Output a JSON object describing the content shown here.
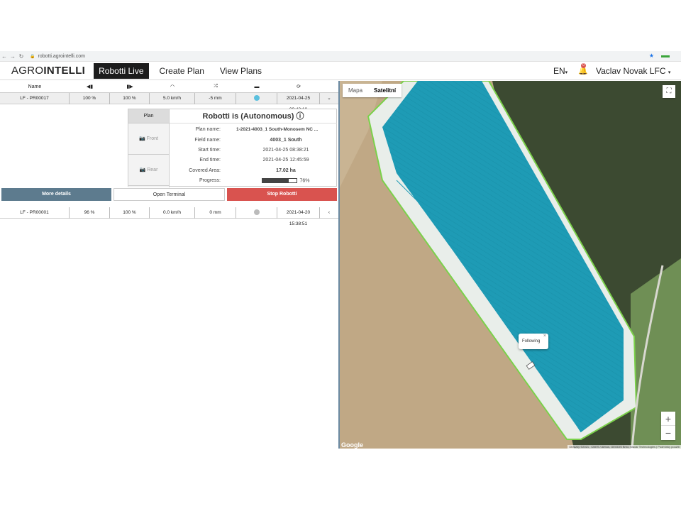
{
  "browser": {
    "url": "robotti.agrointelli.com"
  },
  "header": {
    "logo_light": "AGRO",
    "logo_bold": "INTELLI",
    "tabs": [
      {
        "label": "Robotti Live",
        "active": true
      },
      {
        "label": "Create Plan"
      },
      {
        "label": "View Plans"
      }
    ],
    "language": "EN",
    "notification_count": "0",
    "user": "Vaclav Novak LFC"
  },
  "table": {
    "name_header": "Name",
    "header_icons": [
      "fuel-left-icon",
      "fuel-icon",
      "speedometer-icon",
      "shuffle-icon",
      "monitor-icon",
      "refresh-icon"
    ],
    "rows": [
      {
        "name": "LF - PR00017",
        "fuel1": "100 %",
        "fuel2": "100 %",
        "speed": "5.0 km/h",
        "depth": "-5 mm",
        "status_color": "#5bc0de",
        "time": "2021-04-25 09:42:10",
        "toggle": "⌄"
      },
      {
        "name": "LF - PR00001",
        "fuel1": "96 %",
        "fuel2": "100 %",
        "speed": "0.0 km/h",
        "depth": "0 mm",
        "status_color": "#bbbbbb",
        "time": "2021-04-20 15:38:51",
        "toggle": "‹"
      }
    ]
  },
  "detail": {
    "tab_plan": "Plan",
    "tab_front": "Front",
    "tab_rear": "Rear",
    "title": "Robotti is (Autonomous)",
    "fields": [
      {
        "key": "Plan name:",
        "value": "1-2021-4003_1 South-Monosem NC ..."
      },
      {
        "key": "Field name:",
        "value": "4003_1 South"
      },
      {
        "key": "Start time:",
        "value": "2021-04-25 08:38:21"
      },
      {
        "key": "End time:",
        "value": "2021-04-25 12:45:59"
      },
      {
        "key": "Covered Area:",
        "value": "17.02 ha"
      }
    ],
    "progress_label": "Progress:",
    "progress_value": 76,
    "progress_text": "76%"
  },
  "actions": {
    "more": "More details",
    "terminal": "Open Terminal",
    "stop": "Stop Robotti"
  },
  "map": {
    "type_map": "Mapa",
    "type_satellite": "Satelitní",
    "popup": "Following",
    "google": "Google",
    "copyright": "Obrázky ©2021 , CNES / Airbus, GEODIS Brno, Maxar Technologies | Podmínky použití",
    "field_color": "#1e9bb5"
  }
}
